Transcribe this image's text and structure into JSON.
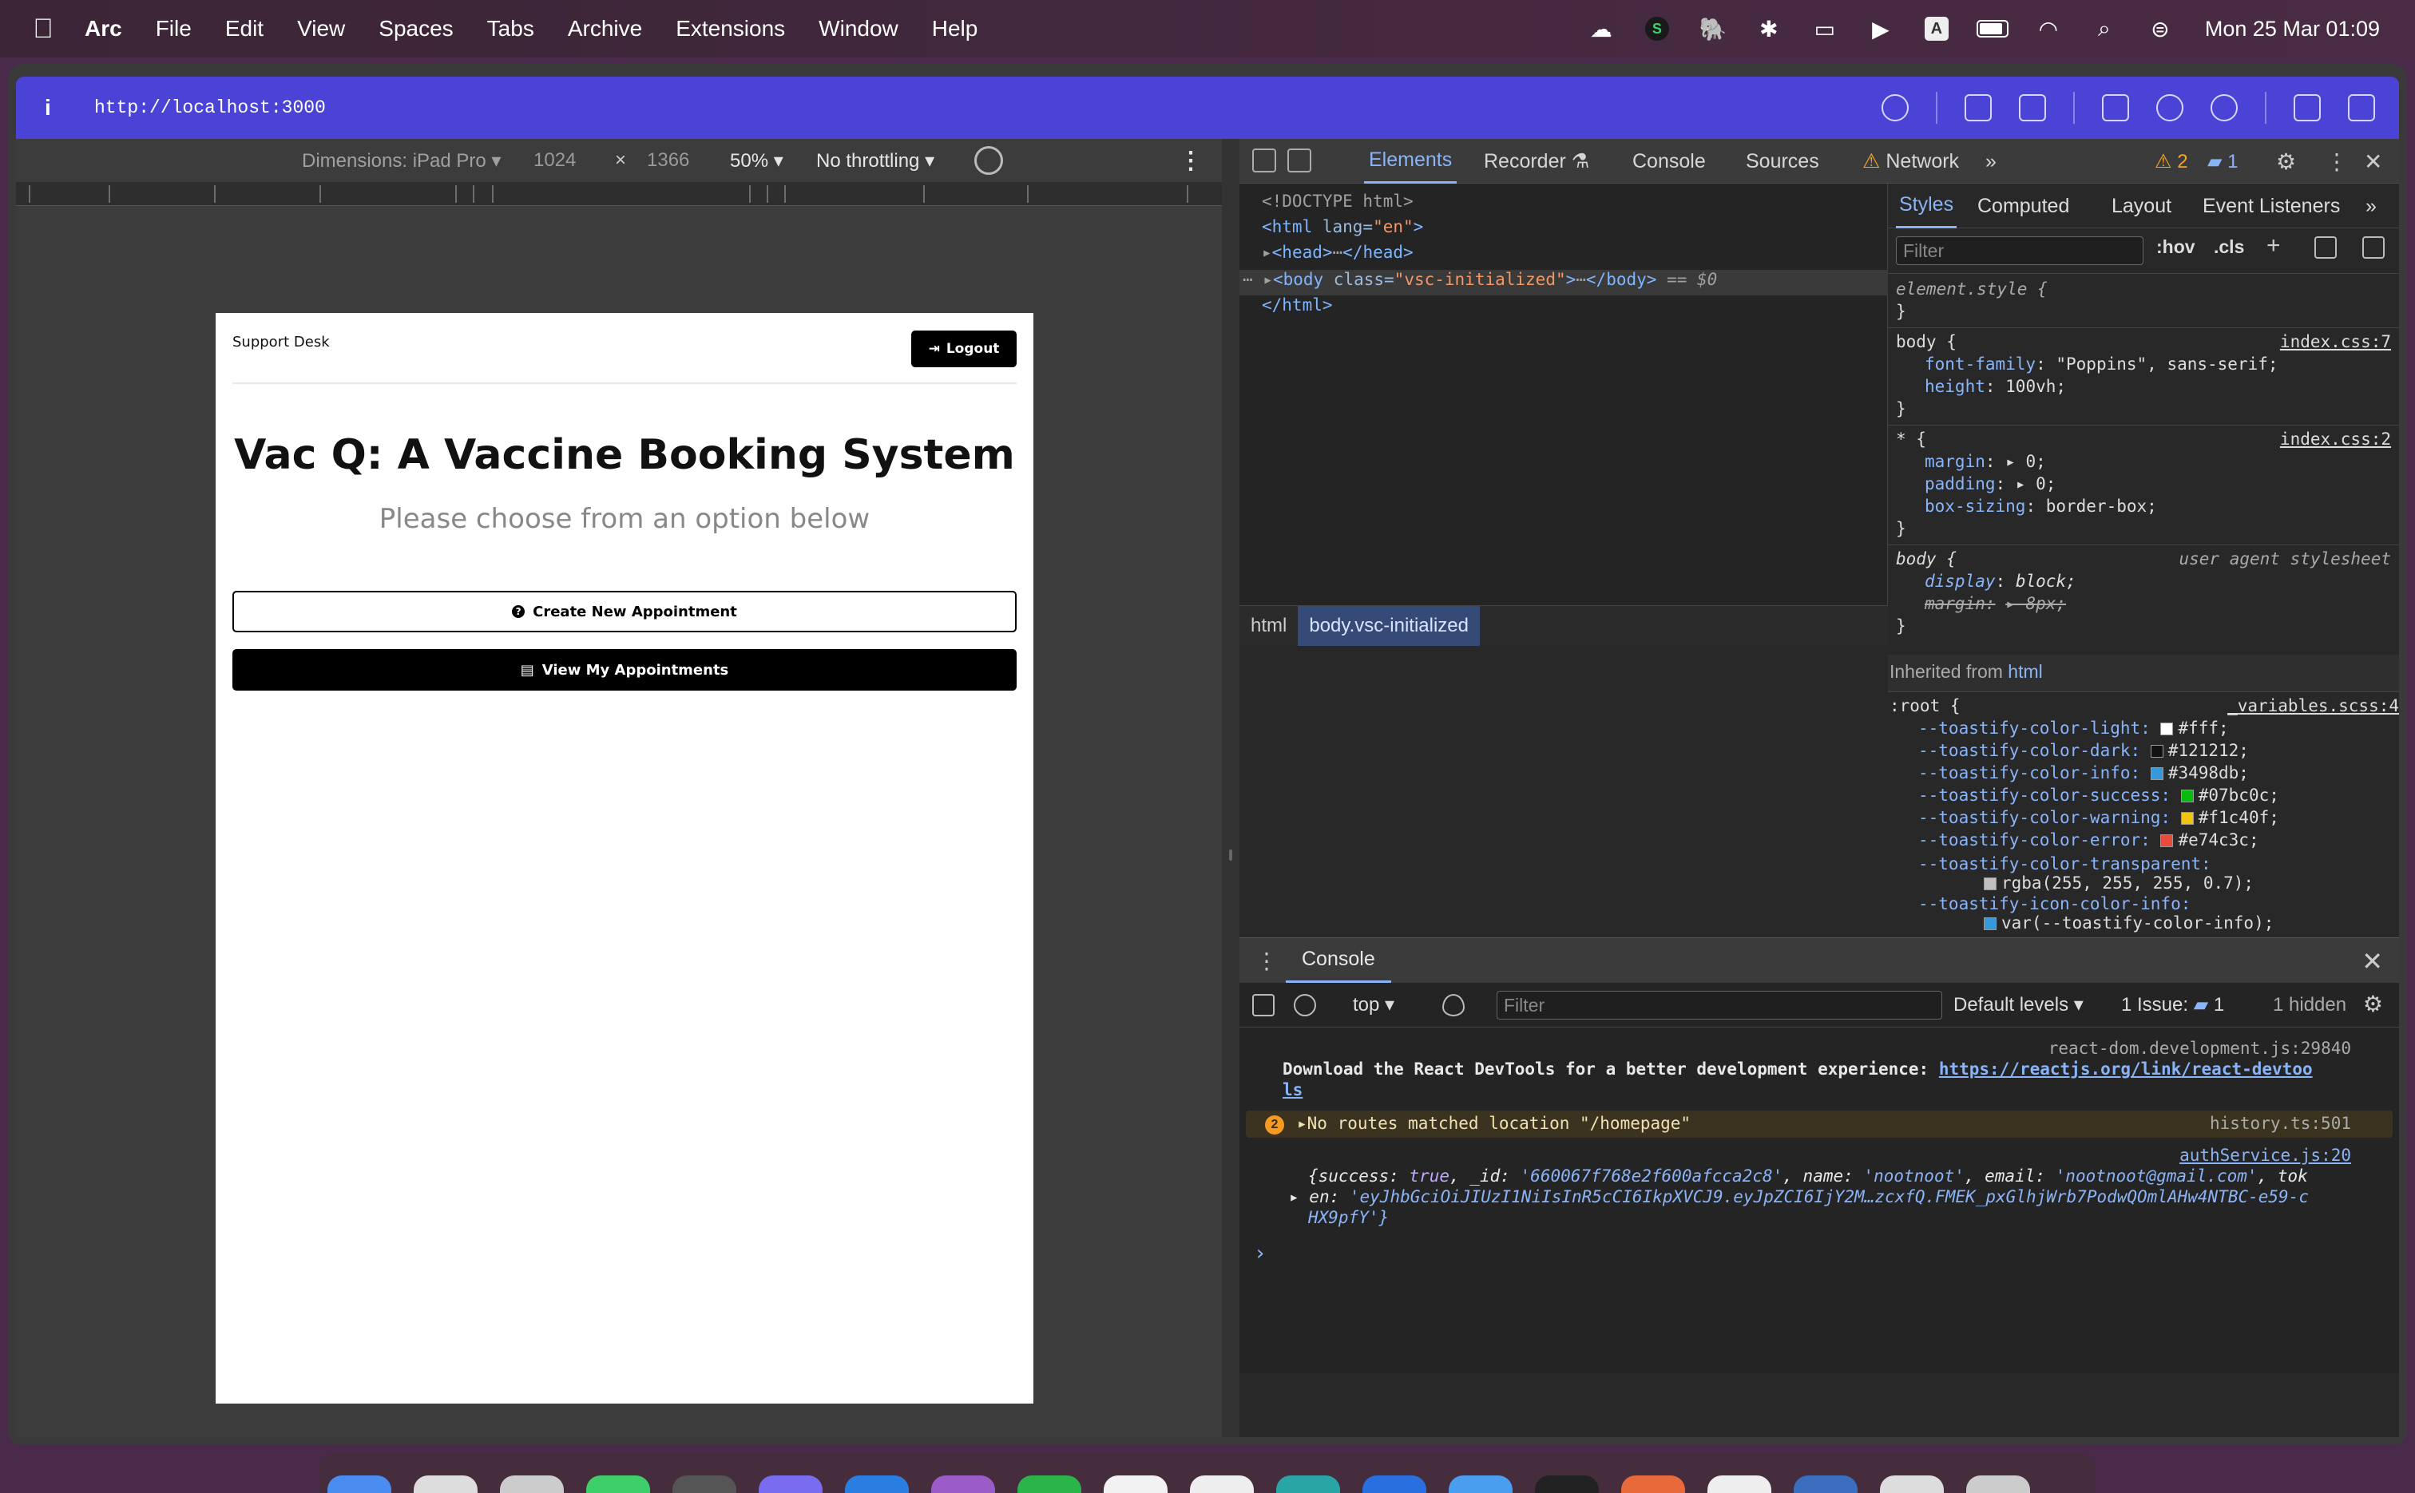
{
  "menubar": {
    "app_name": "Arc",
    "items": [
      "File",
      "Edit",
      "View",
      "Spaces",
      "Tabs",
      "Archive",
      "Extensions",
      "Window",
      "Help"
    ],
    "clock": "Mon 25 Mar  01:09",
    "status_icons": [
      "cloud-icon",
      "s-app-icon",
      "elephant-icon",
      "bluetooth-icon",
      "car-icon",
      "play-icon",
      "input-source-icon",
      "battery-icon",
      "wifi-icon",
      "search-icon",
      "control-center-icon"
    ]
  },
  "urlbar": {
    "info_glyph": "i",
    "url": "http://localhost:3000"
  },
  "device_toolbar": {
    "dimensions": "Dimensions: iPad Pro ▾",
    "width": "1024",
    "times": "×",
    "height": "1366",
    "zoom": "50% ▾",
    "throttling": "No throttling ▾",
    "more": "⋮"
  },
  "device_page": {
    "brand": "Support Desk",
    "logout": "Logout",
    "title": "Vac Q: A Vaccine Booking System",
    "subtitle": "Please choose from an option below",
    "create_btn": "Create New Appointment",
    "view_btn": "View My Appointments"
  },
  "devtools": {
    "tabs": [
      "Elements",
      "Recorder",
      "Console",
      "Sources",
      "Network"
    ],
    "more_tabs": "»",
    "warning_count": "2",
    "message_count": "1",
    "dom": {
      "doctype": "<!DOCTYPE html>",
      "html_open_tag": "<html",
      "html_attr": " lang=",
      "html_attr_val": "\"en\"",
      "html_close_bracket": ">",
      "head_line": "<head>",
      "head_end": "</head>",
      "body_tag": "<body",
      "body_attr": " class=",
      "body_attr_val": "\"vsc-initialized\"",
      "body_close": ">",
      "body_end": "</body>",
      "dollar": " == $0",
      "html_end": "</html>"
    },
    "breadcrumbs": [
      "html",
      "body.vsc-initialized"
    ],
    "styles": {
      "tabs": [
        "Styles",
        "Computed",
        "Layout",
        "Event Listeners",
        "»"
      ],
      "filter_placeholder": "Filter",
      "hov": ":hov",
      "cls": ".cls",
      "element_style": "element.style {",
      "close_brace": "}",
      "rule1_selector": "body {",
      "rule1_source": "index.css:7",
      "rule1_prop1": "font-family",
      "rule1_val1": "\"Poppins\", sans-serif;",
      "rule1_prop2": "height",
      "rule1_val2": "100vh;",
      "rule2_selector": "* {",
      "rule2_source": "index.css:2",
      "rule2_prop1": "margin",
      "rule2_val1": "▸ 0;",
      "rule2_prop2": "padding",
      "rule2_val2": "▸ 0;",
      "rule2_prop3": "box-sizing",
      "rule2_val3": "border-box;",
      "rule3_selector": "body {",
      "rule3_source": "user agent stylesheet",
      "rule3_prop1": "display",
      "rule3_val1": "block;",
      "rule3_prop2": "margin:",
      "rule3_val2": "▸ 8px;",
      "inherited_label": "Inherited from ",
      "inherited_el": "html",
      "root_selector": ":root {",
      "root_source": "_variables.scss:4",
      "vars": [
        {
          "name": "--toastify-color-light",
          "value": "#fff;",
          "color": "#ffffff"
        },
        {
          "name": "--toastify-color-dark",
          "value": "#121212;",
          "color": "#121212"
        },
        {
          "name": "--toastify-color-info",
          "value": "#3498db;",
          "color": "#3498db"
        },
        {
          "name": "--toastify-color-success",
          "value": "#07bc0c;",
          "color": "#07bc0c"
        },
        {
          "name": "--toastify-color-warning",
          "value": "#f1c40f;",
          "color": "#f1c40f"
        },
        {
          "name": "--toastify-color-error",
          "value": "#e74c3c;",
          "color": "#e74c3c"
        }
      ],
      "transparent_name": "--toastify-color-transparent:",
      "transparent_value": "rgba(255, 255, 255, 0.7);",
      "icon_info_name": "--toastify-icon-color-info:",
      "icon_info_value": "var(--toastify-color-info);"
    },
    "console": {
      "tab": "Console",
      "context": "top ▾",
      "filter_placeholder": "Filter",
      "levels": "Default levels ▾",
      "issue_label": "1 Issue:",
      "issue_count": "1",
      "hidden": "1 hidden",
      "src1": "react-dom.development.js:29840",
      "msg1_text": "Download the React DevTools for a better development experience: ",
      "msg1_link_a": "https://reactjs.org/link/react-devtoo",
      "msg1_link_b": "ls",
      "warn_count": "2",
      "warn_text": "▸No routes matched location \"/homepage\"",
      "warn_src": "history.ts:501",
      "src3": "authService.js:20",
      "obj_line1_a": "{success: ",
      "obj_line1_true": "true",
      "obj_line1_b": ", _id: ",
      "obj_line1_id": "'660067f768e2f600afcca2c8'",
      "obj_line1_c": ", name: ",
      "obj_line1_name": "'nootnoot'",
      "obj_line1_d": ", email: ",
      "obj_line1_email": "'nootnoot@gmail.com'",
      "obj_line1_e": ", tok",
      "obj_line2_a": "en: ",
      "obj_line2_token": "'eyJhbGciOiJIUzI1NiIsInR5cCI6IkpXVCJ9.eyJpZCI6IjY2M…zcxfQ.FMEK_pxGlhjWrb7PodwQOmlAHw4NTBC-e59-c",
      "obj_line3": "HX9pfY'}",
      "prompt": "›"
    }
  },
  "colors": {
    "url_bar": "#4b43d6",
    "accent": "#8ab4f8",
    "warning": "#f5a623"
  }
}
